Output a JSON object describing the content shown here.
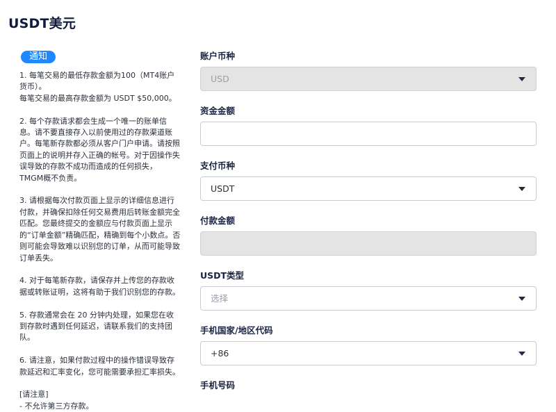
{
  "page": {
    "title": "USDT美元"
  },
  "notice": {
    "badge": "通知",
    "text": "1. 每笔交易的最低存款金额为100（MT4账户货币）。\n每笔交易的最高存款金额为 USDT $50,000。\n\n2. 每个存款请求都会生成一个唯一的账单信息。请不要直接存入以前使用过的存款渠道账户。每笔新存款都必须从客户门户申请。请按照页面上的说明并存入正确的帐号。对于因操作失误导致的存款不成功而造成的任何损失，TMGM概不负责。\n\n3. 请根据每次付款页面上显示的详细信息进行付款，并确保扣除任何交易费用后转账金额完全匹配。您最终提交的金额应与付款页面上显示的“订单金额”精确匹配，精确到每个小数点。否则可能会导致难以识别您的订单，从而可能导致订单丢失。\n\n4. 对于每笔新存款，请保存并上传您的存款收据或转账证明，这将有助于我们识别您的存款。\n\n5. 存款通常会在 20 分钟内处理，如果您在收到存款时遇到任何延迟，请联系我们的支持团队。\n\n6. 请注意，如果付款过程中的操作错误导致存款延迟和汇率变化，您可能需要承担汇率损失。\n\n[请注意]\n- 不允许第三方存款。"
  },
  "form": {
    "account_currency": {
      "label": "账户币种",
      "value": "USD"
    },
    "deposit_amount": {
      "label": "资金金额",
      "value": ""
    },
    "payment_currency": {
      "label": "支付币种",
      "value": "USDT"
    },
    "payment_amount": {
      "label": "付款金额",
      "value": ""
    },
    "usdt_type": {
      "label": "USDT类型",
      "placeholder": "选择"
    },
    "phone_country_code": {
      "label": "手机国家/地区代码",
      "value": "+86"
    },
    "phone_number": {
      "label": "手机号码"
    }
  }
}
